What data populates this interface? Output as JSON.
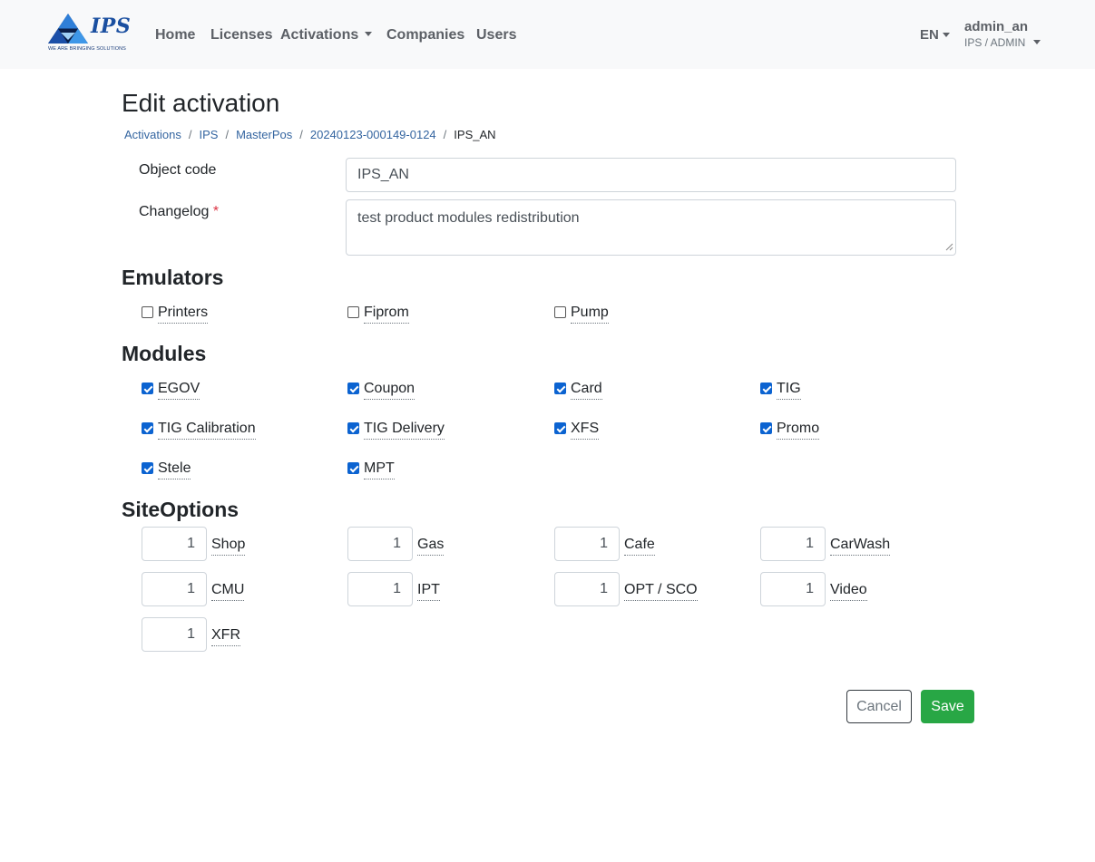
{
  "brand": {
    "name": "IPS",
    "tagline": "WE ARE BRINGING SOLUTIONS",
    "color": "#1a4fa0"
  },
  "nav": {
    "items": [
      "Home",
      "Licenses",
      "Activations",
      "Companies",
      "Users"
    ],
    "language": "EN",
    "user_name": "admin_an",
    "user_role": "IPS / ADMIN"
  },
  "page": {
    "title": "Edit activation",
    "breadcrumb": [
      "Activations",
      "IPS",
      "MasterPos",
      "20240123-000149-0124",
      "IPS_AN"
    ]
  },
  "form": {
    "object_code_label": "Object code",
    "object_code_value": "IPS_AN",
    "changelog_label": "Changelog",
    "required_mark": "*",
    "changelog_value": "test product modules redistribution"
  },
  "emulators": {
    "title": "Emulators",
    "items": [
      {
        "label": "Printers",
        "checked": false
      },
      {
        "label": "Fiprom",
        "checked": false
      },
      {
        "label": "Pump",
        "checked": false
      }
    ]
  },
  "modules": {
    "title": "Modules",
    "items": [
      {
        "label": "EGOV",
        "checked": true
      },
      {
        "label": "Coupon",
        "checked": true
      },
      {
        "label": "Card",
        "checked": true
      },
      {
        "label": "TIG",
        "checked": true
      },
      {
        "label": "TIG Calibration",
        "checked": true
      },
      {
        "label": "TIG Delivery",
        "checked": true
      },
      {
        "label": "XFS",
        "checked": true
      },
      {
        "label": "Promo",
        "checked": true
      },
      {
        "label": "Stele",
        "checked": true
      },
      {
        "label": "MPT",
        "checked": true
      }
    ]
  },
  "site_options": {
    "title": "SiteOptions",
    "items": [
      {
        "label": "Shop",
        "value": "1"
      },
      {
        "label": "Gas",
        "value": "1"
      },
      {
        "label": "Cafe",
        "value": "1"
      },
      {
        "label": "CarWash",
        "value": "1"
      },
      {
        "label": "CMU",
        "value": "1"
      },
      {
        "label": "IPT",
        "value": "1"
      },
      {
        "label": "OPT / SCO",
        "value": "1"
      },
      {
        "label": "Video",
        "value": "1"
      },
      {
        "label": "XFR",
        "value": "1"
      }
    ]
  },
  "actions": {
    "cancel": "Cancel",
    "save": "Save"
  },
  "colors": {
    "primary": "#0b63d1",
    "success": "#28a745",
    "danger": "#dc3545",
    "link": "#3465a0"
  }
}
